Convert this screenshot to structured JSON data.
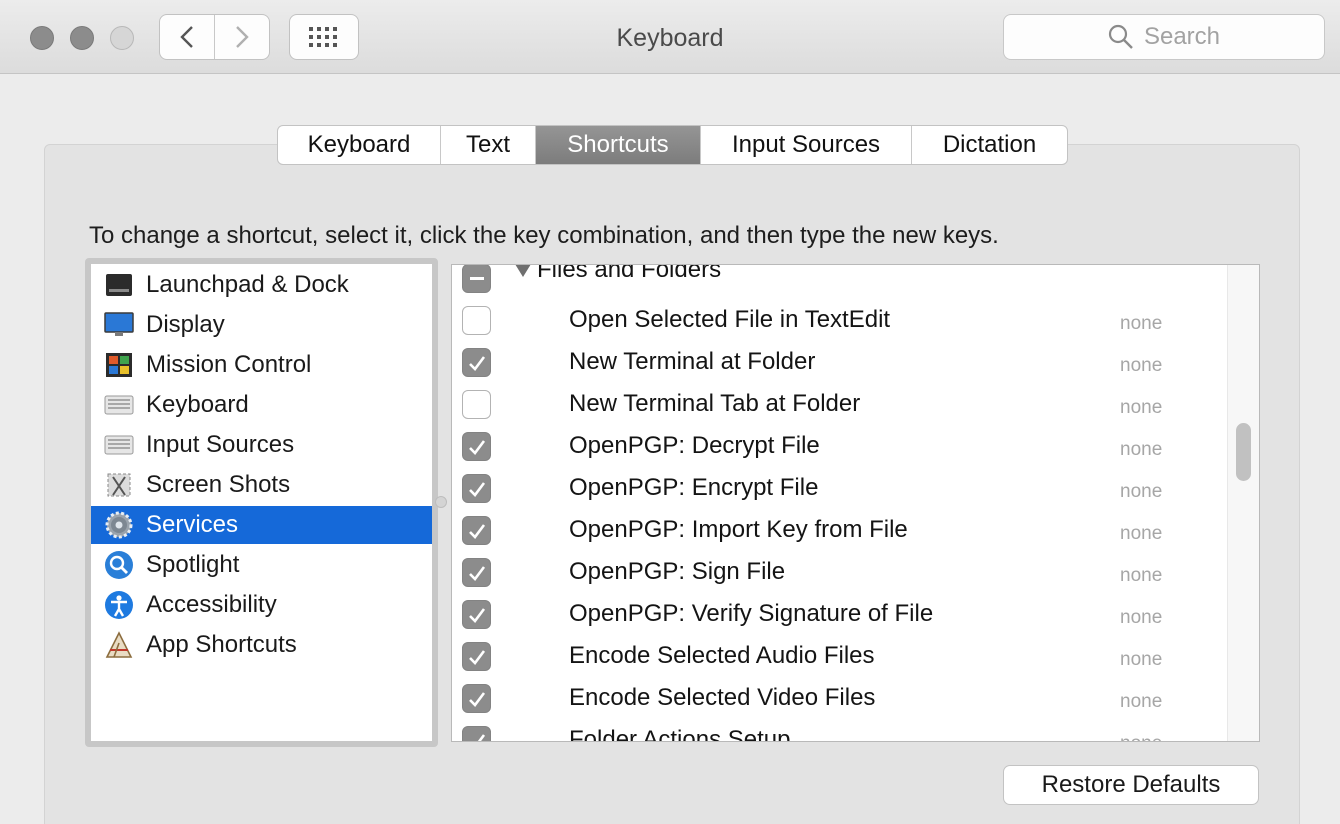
{
  "window": {
    "title": "Keyboard"
  },
  "search": {
    "placeholder": "Search",
    "icon": "search-icon"
  },
  "tabs": [
    {
      "label": "Keyboard"
    },
    {
      "label": "Text"
    },
    {
      "label": "Shortcuts",
      "selected": true
    },
    {
      "label": "Input Sources"
    },
    {
      "label": "Dictation"
    }
  ],
  "instructions": "To change a shortcut, select it, click the key combination, and then type the new keys.",
  "categories": [
    {
      "label": "Launchpad & Dock",
      "icon": "launchpad-dock-icon"
    },
    {
      "label": "Display",
      "icon": "display-icon"
    },
    {
      "label": "Mission Control",
      "icon": "mission-control-icon"
    },
    {
      "label": "Keyboard",
      "icon": "keyboard-icon"
    },
    {
      "label": "Input Sources",
      "icon": "input-sources-icon"
    },
    {
      "label": "Screen Shots",
      "icon": "screen-shots-icon"
    },
    {
      "label": "Services",
      "icon": "services-gear-icon",
      "selected": true
    },
    {
      "label": "Spotlight",
      "icon": "spotlight-icon"
    },
    {
      "label": "Accessibility",
      "icon": "accessibility-icon"
    },
    {
      "label": "App Shortcuts",
      "icon": "app-shortcuts-icon"
    }
  ],
  "shortcuts": {
    "group": {
      "label": "Files and Folders",
      "state": "mixed",
      "expanded": true
    },
    "items": [
      {
        "label": "Open Selected File in TextEdit",
        "checked": false,
        "key": "none"
      },
      {
        "label": "New Terminal at Folder",
        "checked": true,
        "key": "none"
      },
      {
        "label": "New Terminal Tab at Folder",
        "checked": false,
        "key": "none"
      },
      {
        "label": "OpenPGP: Decrypt File",
        "checked": true,
        "key": "none"
      },
      {
        "label": "OpenPGP: Encrypt File",
        "checked": true,
        "key": "none"
      },
      {
        "label": "OpenPGP: Import Key from File",
        "checked": true,
        "key": "none"
      },
      {
        "label": "OpenPGP: Sign File",
        "checked": true,
        "key": "none"
      },
      {
        "label": "OpenPGP: Verify Signature of File",
        "checked": true,
        "key": "none"
      },
      {
        "label": "Encode Selected Audio Files",
        "checked": true,
        "key": "none"
      },
      {
        "label": "Encode Selected Video Files",
        "checked": true,
        "key": "none"
      },
      {
        "label": "Folder Actions Setup...",
        "checked": true,
        "key": "none"
      }
    ]
  },
  "restore_button": {
    "label": "Restore Defaults"
  },
  "colors": {
    "selection": "#1569d9",
    "checkbox_checked": "#8c8c8c"
  }
}
